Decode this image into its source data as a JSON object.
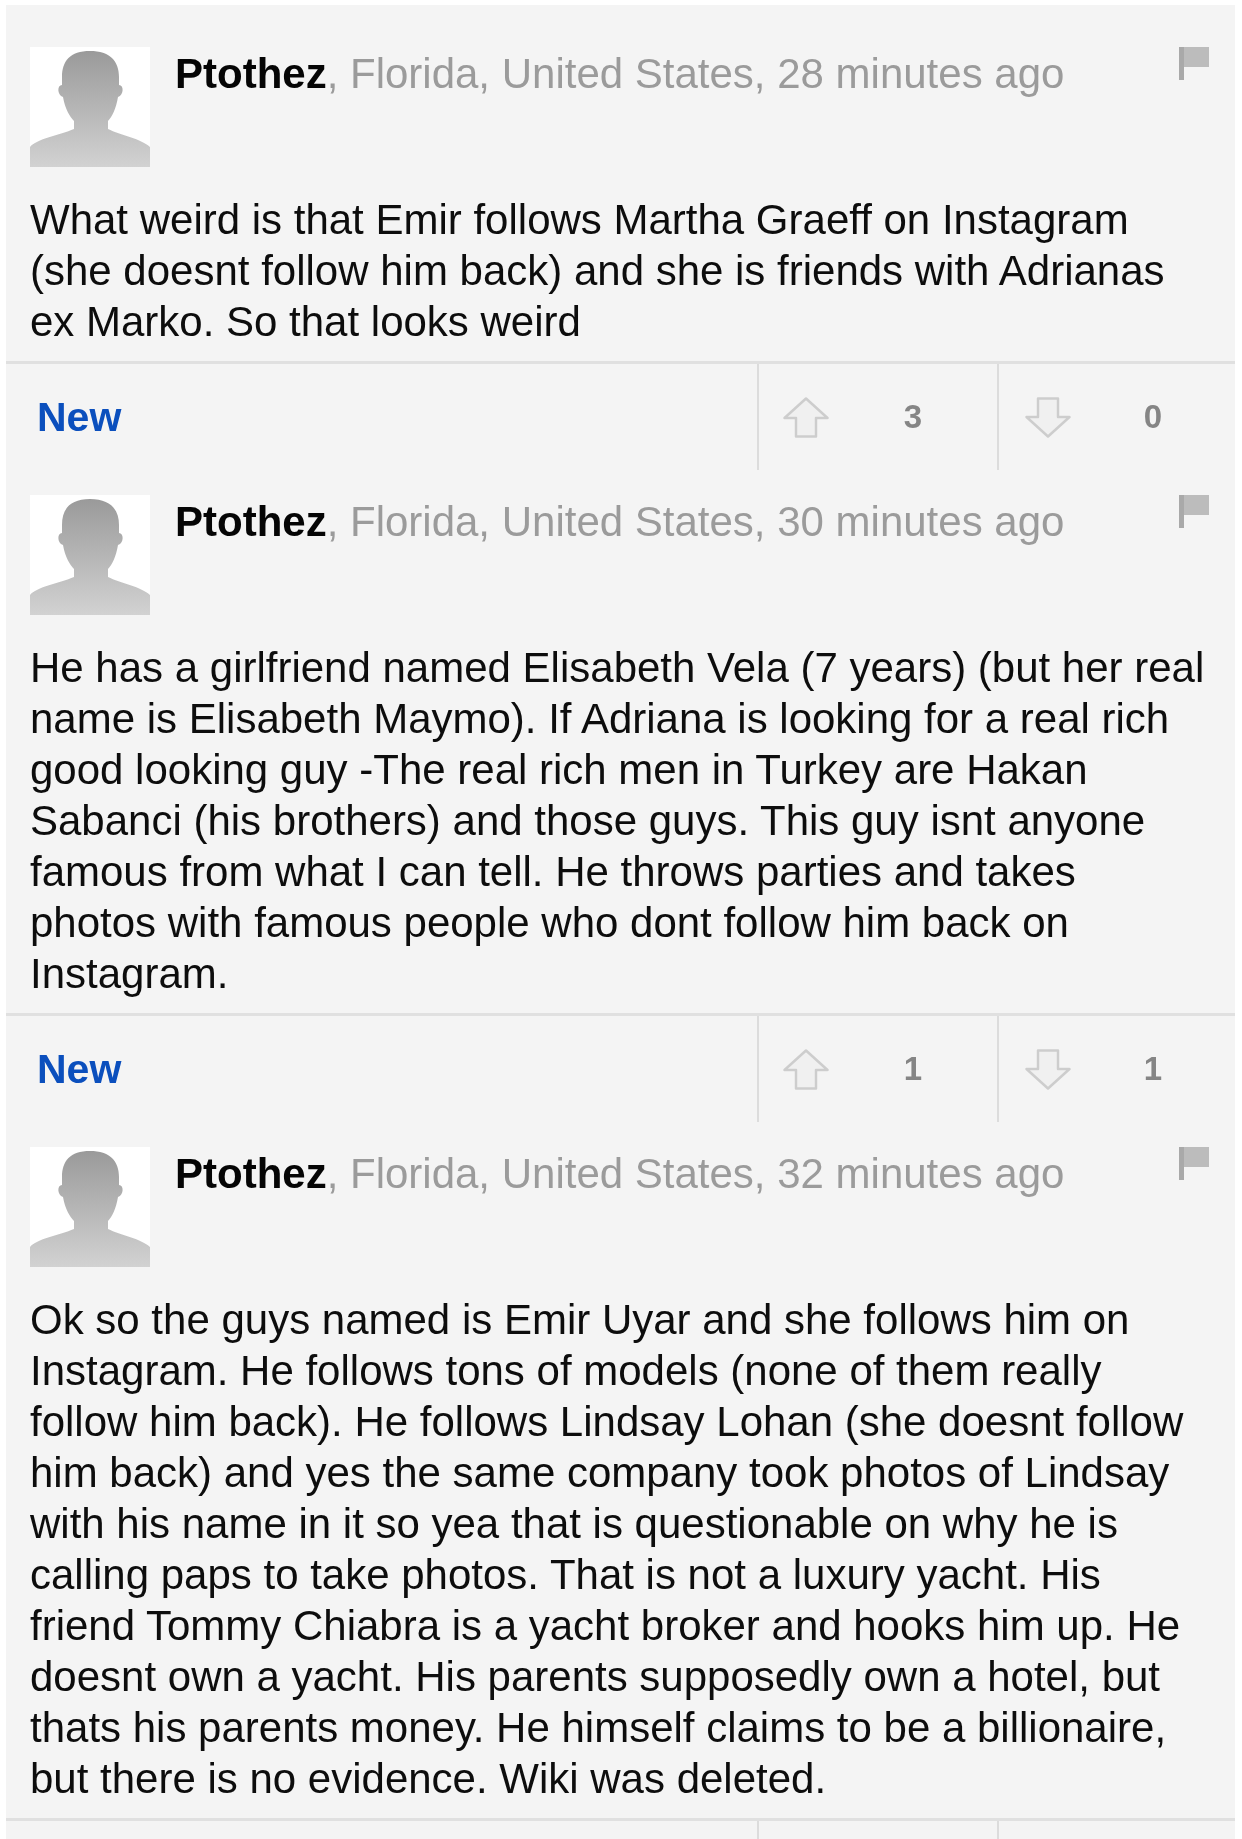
{
  "comments": [
    {
      "author": "Ptothez",
      "meta": ", Florida, United States, 28 minutes ago",
      "text": "What weird is that Emir follows Martha Graeff on Instagram (she doesnt follow him back) and she is friends with Adrianas ex Marko. So that looks weird",
      "footer": {
        "tag": "New",
        "up_count": "3",
        "down_count": "0"
      }
    },
    {
      "author": "Ptothez",
      "meta": ", Florida, United States, 30 minutes ago",
      "text": "He has a girlfriend named Elisabeth Vela (7 years) (but her real name is Elisabeth Maymo). If Adriana is looking for a real rich good looking guy -The real rich men in Turkey are Hakan Sabanci (his brothers) and those guys. This guy isnt anyone famous from what I can tell. He throws parties and takes photos with famous people who dont follow him back on Instagram.",
      "footer": {
        "tag": "New",
        "up_count": "1",
        "down_count": "1"
      }
    },
    {
      "author": "Ptothez",
      "meta": ", Florida, United States, 32 minutes ago",
      "text": "Ok so the guys named is Emir Uyar and she follows him on Instagram. He follows tons of models (none of them really follow him back). He follows Lindsay Lohan (she doesnt follow him back) and yes the same company took photos of Lindsay with his name in it so yea that is questionable on why he is calling paps to take photos. That is not a luxury yacht. His friend Tommy Chiabra is a yacht broker and hooks him up. He doesnt own a yacht. His parents supposedly own a hotel, but thats his parents money. He himself claims to be a billionaire, but there is no evidence. Wiki was deleted."
    }
  ]
}
